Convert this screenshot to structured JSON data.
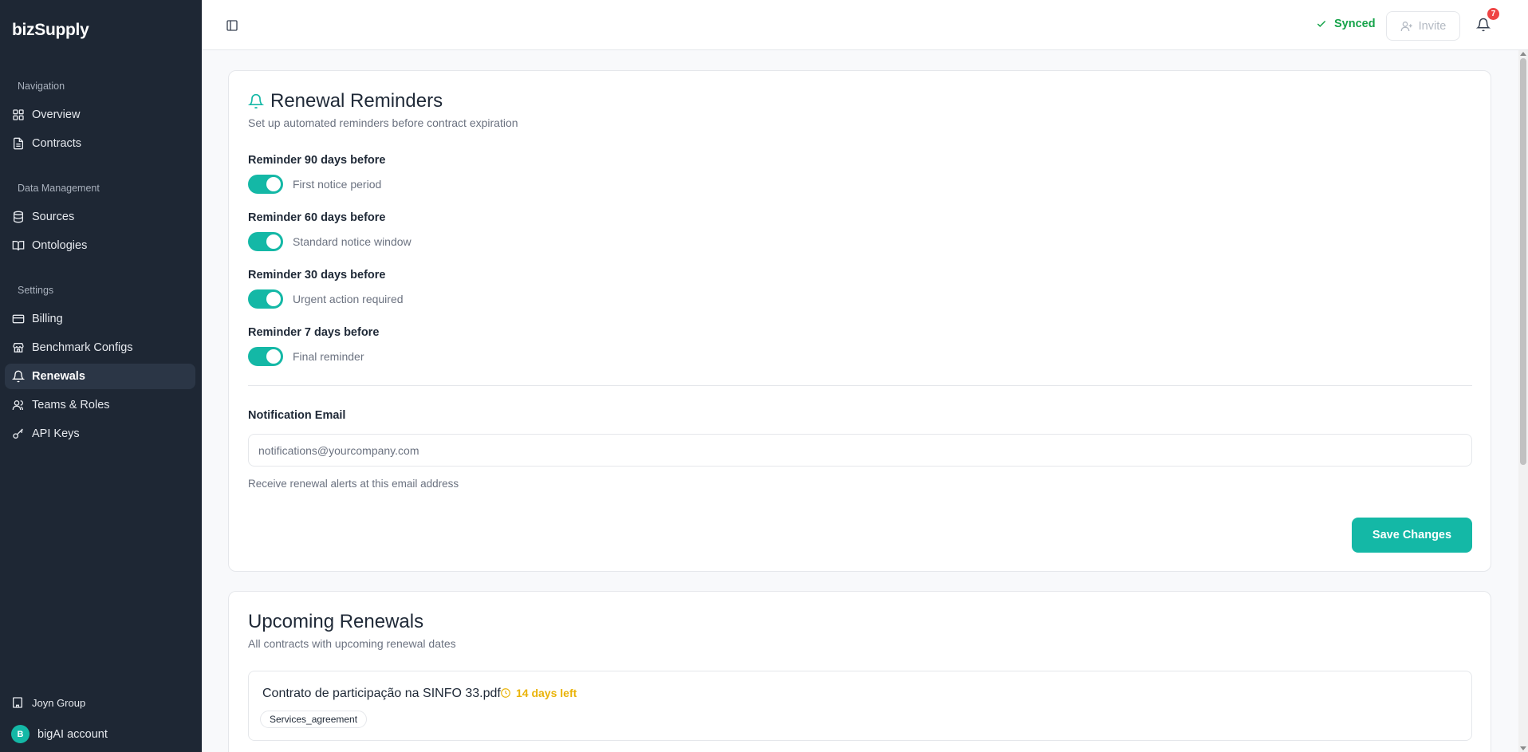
{
  "app": {
    "name": "bizSupply"
  },
  "sidebar": {
    "sections": [
      {
        "title": "Navigation",
        "items": [
          {
            "label": "Overview",
            "icon": "grid-icon"
          },
          {
            "label": "Contracts",
            "icon": "file-icon"
          }
        ]
      },
      {
        "title": "Data Management",
        "items": [
          {
            "label": "Sources",
            "icon": "database-icon"
          },
          {
            "label": "Ontologies",
            "icon": "book-open-icon"
          }
        ]
      },
      {
        "title": "Settings",
        "items": [
          {
            "label": "Billing",
            "icon": "credit-card-icon"
          },
          {
            "label": "Benchmark Configs",
            "icon": "store-icon"
          },
          {
            "label": "Renewals",
            "icon": "bell-icon",
            "active": true
          },
          {
            "label": "Teams & Roles",
            "icon": "users-icon"
          },
          {
            "label": "API Keys",
            "icon": "key-icon"
          }
        ]
      }
    ],
    "org": {
      "label": "Joyn Group",
      "icon": "building-icon"
    },
    "account": {
      "initial": "B",
      "label": "bigAI account"
    }
  },
  "header": {
    "status": "Synced",
    "invite_label": "Invite",
    "notification_count": "7"
  },
  "reminders_card": {
    "title": "Renewal Reminders",
    "subtitle": "Set up automated reminders before contract expiration",
    "reminders": [
      {
        "label": "Reminder 90 days before",
        "description": "First notice period",
        "enabled": true
      },
      {
        "label": "Reminder 60 days before",
        "description": "Standard notice window",
        "enabled": true
      },
      {
        "label": "Reminder 30 days before",
        "description": "Urgent action required",
        "enabled": true
      },
      {
        "label": "Reminder 7 days before",
        "description": "Final reminder",
        "enabled": true
      }
    ],
    "email": {
      "label": "Notification Email",
      "value": "",
      "placeholder": "notifications@yourcompany.com",
      "help": "Receive renewal alerts at this email address"
    },
    "save_label": "Save Changes"
  },
  "upcoming_card": {
    "title": "Upcoming Renewals",
    "subtitle": "All contracts with upcoming renewal dates",
    "items": [
      {
        "name": "Contrato de participação na SINFO 33.pdf",
        "days_left": "14 days left",
        "tag": "Services_agreement"
      }
    ]
  },
  "colors": {
    "accent": "#14b8a6",
    "sidebar_bg": "#1e2734",
    "synced": "#16a34a",
    "warning": "#eab308",
    "badge": "#ef4444"
  }
}
